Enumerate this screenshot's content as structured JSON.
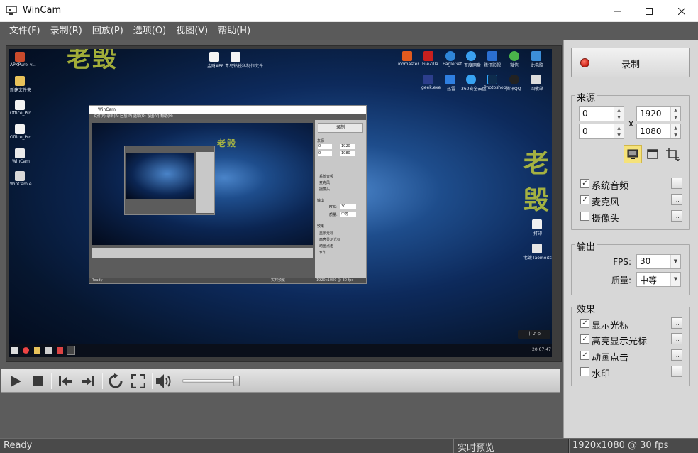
{
  "window": {
    "title": "WinCam"
  },
  "menu": [
    {
      "label": "文件(F)"
    },
    {
      "label": "录制(R)"
    },
    {
      "label": "回放(P)"
    },
    {
      "label": "选项(O)"
    },
    {
      "label": "视图(V)"
    },
    {
      "label": "帮助(H)"
    }
  ],
  "preview": {
    "desktop_icons_left": [
      "APKPure_v...",
      "新建文件夹",
      "Office_Pro...",
      "Office_Pro...",
      "WinCam",
      "WinCam.e..."
    ],
    "desktop_icons_top_center": [
      "金财APP",
      "青岛钻锐科制作文件"
    ],
    "desktop_icons_top_right": [
      "icomaster",
      "FileZilla",
      "EagleGet",
      "百度网盘",
      "腾讯影视",
      "微信",
      "此电脑"
    ],
    "desktop_icons_second_row": [
      "geek.exe",
      "迅雷",
      "360安全云盘",
      "Photoshop",
      "腾讯QQ",
      "回收站"
    ],
    "desktop_icons_right": [
      "打印",
      "老毁 laomoitco..."
    ],
    "watermark": "老毁",
    "tray_text": "中 ♪ ⊙",
    "taskbar_time": "20:07:47",
    "inner_window": {
      "title": "WinCam",
      "menu": "文件(F)  录制(R)  回放(P)  选项(O)  视图(V)  帮助(H)",
      "record": "录制",
      "source": "来源",
      "output": "输出",
      "effects": "效果",
      "fps_label": "FPS:",
      "fps_value": "30",
      "quality_label": "质量:",
      "quality_value": "中等",
      "src_x": "0",
      "src_y": "0",
      "src_w": "1920",
      "src_h": "1080",
      "source_options": [
        "系统音频",
        "麦克风",
        "摄像头"
      ],
      "effect_options": [
        "显示光标",
        "高亮显示光标",
        "动画点击",
        "水印"
      ],
      "status_left": "Ready",
      "status_mid": "实时预览",
      "status_right": "1920x1080 @ 30 fps"
    }
  },
  "controls": {
    "play": "play-icon",
    "stop": "stop-icon",
    "prev": "skip-start-icon",
    "next": "skip-end-icon",
    "loop": "loop-icon",
    "fullscreen": "fullscreen-icon",
    "volume": "volume-icon",
    "volume_level": 0.95
  },
  "panel": {
    "record_label": "录制",
    "source": {
      "title": "来源",
      "x": "0",
      "y": "0",
      "width": "1920",
      "height": "1080",
      "x_sep": "x",
      "modes": [
        "monitor-icon",
        "window-icon",
        "crop-icon"
      ],
      "active_mode": "monitor-icon",
      "options": [
        {
          "label": "系统音频",
          "checked": true
        },
        {
          "label": "麦克风",
          "checked": true
        },
        {
          "label": "摄像头",
          "checked": false
        }
      ]
    },
    "output": {
      "title": "输出",
      "fps_label": "FPS:",
      "fps_value": "30",
      "quality_label": "质量:",
      "quality_value": "中等"
    },
    "effects": {
      "title": "效果",
      "options": [
        {
          "label": "显示光标",
          "checked": true
        },
        {
          "label": "高亮显示光标",
          "checked": true
        },
        {
          "label": "动画点击",
          "checked": true
        },
        {
          "label": "水印",
          "checked": false
        }
      ]
    },
    "more_button": "..."
  },
  "status": {
    "left": "Ready",
    "mid": "实时预览",
    "right": "1920x1080 @ 30 fps"
  }
}
